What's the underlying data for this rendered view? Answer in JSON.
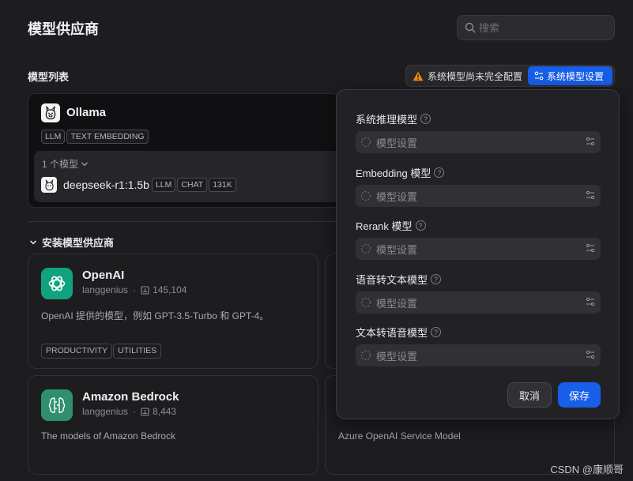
{
  "page": {
    "title": "模型供应商"
  },
  "search": {
    "placeholder": "搜索"
  },
  "model_list": {
    "title": "模型列表",
    "warning_text": "系统模型尚未完全配置",
    "config_button": "系统模型设置"
  },
  "ollama": {
    "name": "Ollama",
    "tags": [
      "LLM",
      "TEXT EMBEDDING"
    ],
    "models_count": "1 个模型",
    "model": {
      "name": "deepseek-r1:1.5b",
      "tags": [
        "LLM",
        "CHAT",
        "131K"
      ]
    }
  },
  "install": {
    "title": "安装模型供应商",
    "providers": [
      {
        "name": "OpenAI",
        "author": "langgenius",
        "installs": "145,104",
        "desc": "OpenAI 提供的模型，例如 GPT-3.5-Turbo 和 GPT-4。",
        "tags": [
          "PRODUCTIVITY",
          "UTILITIES"
        ],
        "color": "#10a37f"
      },
      {
        "name": "Amazon Bedrock",
        "author": "langgenius",
        "installs": "8,443",
        "desc": "The models of Amazon Bedrock",
        "color": "#2f8f6f"
      }
    ],
    "partial_desc": "Azure OpenAI Service Model"
  },
  "popup": {
    "fields": [
      {
        "label": "系统推理模型",
        "placeholder": "模型设置"
      },
      {
        "label": "Embedding 模型",
        "placeholder": "模型设置"
      },
      {
        "label": "Rerank 模型",
        "placeholder": "模型设置"
      },
      {
        "label": "语音转文本模型",
        "placeholder": "模型设置"
      },
      {
        "label": "文本转语音模型",
        "placeholder": "模型设置"
      }
    ],
    "cancel": "取消",
    "save": "保存"
  },
  "watermark": "CSDN @康顺哥",
  "colors": {
    "accent": "#175ee8",
    "warning": "#f79009",
    "background": "#1d1d20"
  }
}
